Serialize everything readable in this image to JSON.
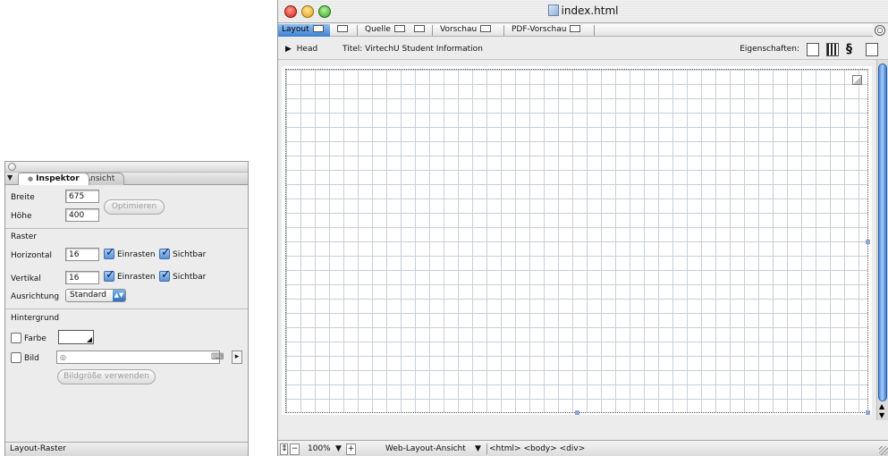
{
  "inspector": {
    "tabs": [
      "Inspektor",
      "Ansicht"
    ],
    "width_label": "Breite",
    "width_value": "675",
    "height_label": "Höhe",
    "height_value": "400",
    "optimize_label": "Optimieren",
    "raster_heading": "Raster",
    "horizontal_label": "Horizontal",
    "horizontal_value": "16",
    "vertical_label": "Vertikal",
    "vertical_value": "16",
    "snap_label": "Einrasten",
    "visible_label": "Sichtbar",
    "alignment_label": "Ausrichtung",
    "alignment_value": "Standard",
    "background_heading": "Hintergrund",
    "color_label": "Farbe",
    "image_label": "Bild",
    "use_image_size_label": "Bildgröße verwenden",
    "status": "Layout-Raster"
  },
  "window": {
    "title": "index.html",
    "modes": [
      "Layout",
      "Quelle",
      "Vorschau",
      "PDF-Vorschau"
    ],
    "head_toggle": "Head",
    "page_title": "Titel: VirtechU Student Information",
    "properties_label": "Eigenschaften:",
    "zoom": "100%",
    "view_mode": "Web-Layout-Ansicht",
    "tag_path": "<html> <body> <div>"
  },
  "colors": {
    "accent": "#3d7fd0",
    "grid_line": "#c8cfd8"
  }
}
